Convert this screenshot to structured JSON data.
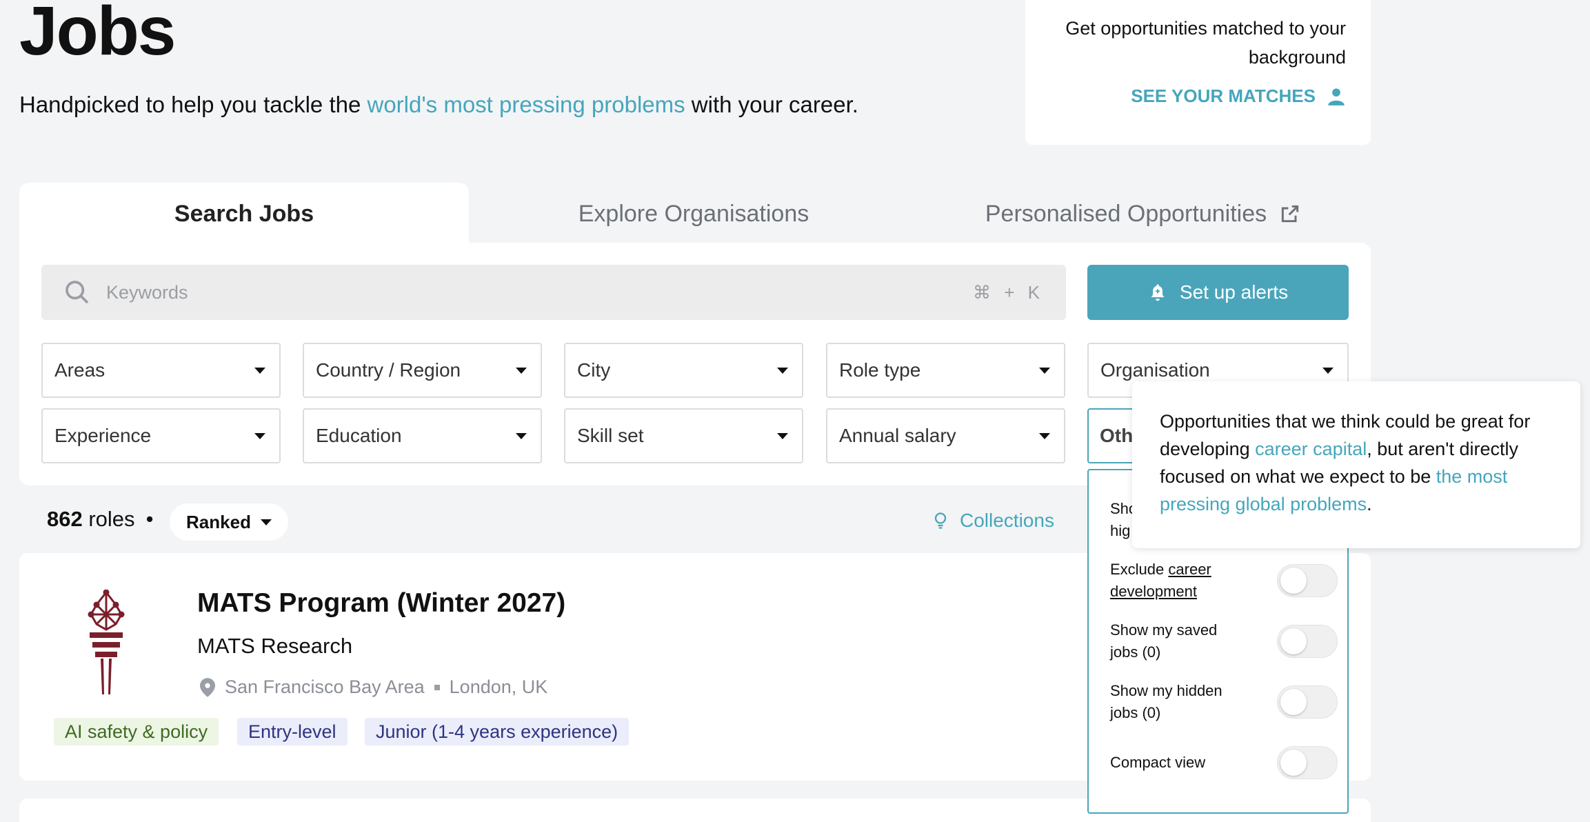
{
  "header": {
    "title": "Jobs",
    "subtitle_before": "Handpicked to help you tackle the ",
    "subtitle_link": "world's most pressing problems",
    "subtitle_after": " with your career."
  },
  "match_card": {
    "text": "Get opportunities matched to your background",
    "link": "SEE YOUR MATCHES",
    "link_icon": "person-icon"
  },
  "tabs": [
    {
      "label": "Search Jobs",
      "active": true
    },
    {
      "label": "Explore Organisations"
    },
    {
      "label": "Personalised Opportunities",
      "icon": "external-link-icon"
    }
  ],
  "search": {
    "placeholder": "Keywords",
    "shortcut": "⌘ + K"
  },
  "alerts_button": "Set up alerts",
  "filters_row1": [
    "Areas",
    "Country / Region",
    "City",
    "Role type",
    "Organisation"
  ],
  "filters_row2": [
    "Experience",
    "Education",
    "Skill set",
    "Annual salary"
  ],
  "other_filter": "Oth",
  "results": {
    "count": "862",
    "count_label": "roles",
    "separator": "•",
    "sort": "Ranked",
    "collections": "Collections"
  },
  "job": {
    "title": "MATS Program (Winter 2027)",
    "org": "MATS Research",
    "locations": [
      "San Francisco Bay Area",
      "London, UK"
    ],
    "tags": [
      "AI safety & policy",
      "Entry-level",
      "Junior (1-4 years experience)"
    ]
  },
  "menu": {
    "partial_label_line1": "Sho",
    "partial_label_line2": "hig",
    "exclude_prefix": "Exclude ",
    "exclude_link_1": "career",
    "exclude_link_2": "development",
    "saved": "Show my saved jobs (0)",
    "hidden": "Show my hidden jobs (0)",
    "compact": "Compact view"
  },
  "tooltip": {
    "t1": "Opportunities that we think could be great for developing ",
    "link1": "career capital",
    "t2": ", but aren't directly focused on what we expect to be ",
    "link2": "the most pressing global problems",
    "t3": "."
  },
  "colors": {
    "accent": "#45a6bb",
    "button": "#4aa5bb",
    "logo": "#7a1f2b"
  }
}
